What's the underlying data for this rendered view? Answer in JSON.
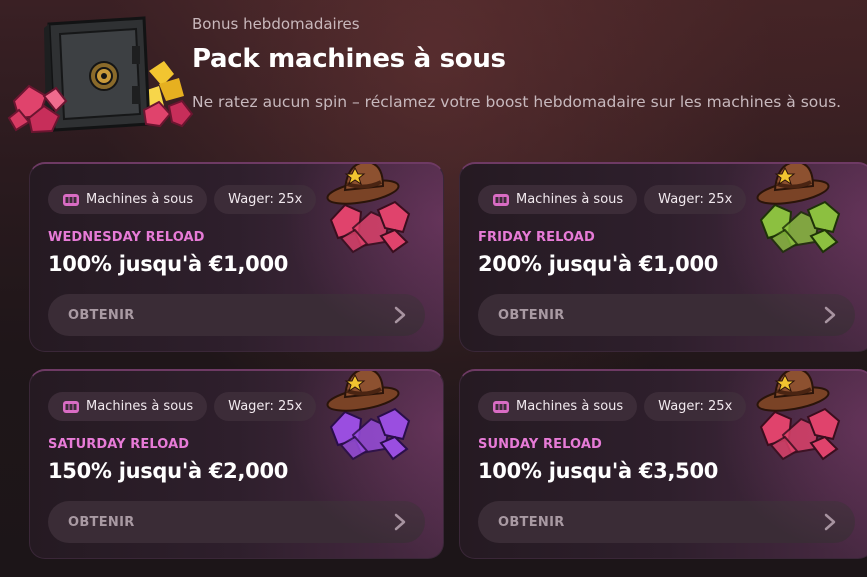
{
  "header": {
    "subtitle": "Bonus hebdomadaires",
    "title": "Pack machines à sous",
    "description": "Ne ratez aucun spin – réclamez votre boost hebdomadaire sur les machines à sous."
  },
  "cards": [
    {
      "chip_category": "Machines à sous",
      "chip_wager": "Wager: 25x",
      "label": "WEDNESDAY RELOAD",
      "offer": "100% jusqu'à €1,000",
      "button": "OBTENIR",
      "gem_color": "#e0436c",
      "icon": "cowboy-hat-pink-gems-icon"
    },
    {
      "chip_category": "Machines à sous",
      "chip_wager": "Wager: 25x",
      "label": "FRIDAY RELOAD",
      "offer": "200% jusqu'à €1,000",
      "button": "OBTENIR",
      "gem_color": "#8cc040",
      "icon": "cowboy-hat-green-gems-icon"
    },
    {
      "chip_category": "Machines à sous",
      "chip_wager": "Wager: 25x",
      "label": "SATURDAY RELOAD",
      "offer": "150% jusqu'à €2,000",
      "button": "OBTENIR",
      "gem_color": "#9a4ee0",
      "icon": "cowboy-hat-purple-gems-icon"
    },
    {
      "chip_category": "Machines à sous",
      "chip_wager": "Wager: 25x",
      "label": "SUNDAY RELOAD",
      "offer": "100% jusqu'à €3,500",
      "button": "OBTENIR",
      "gem_color": "#e0436c",
      "icon": "cowboy-hat-pink-gems-icon"
    }
  ],
  "colors": {
    "label_accent": "#e77bd7",
    "card_bg": "#2e1f2c",
    "chip_bg": "#3c2c38",
    "button_bg": "#3a2c36"
  }
}
